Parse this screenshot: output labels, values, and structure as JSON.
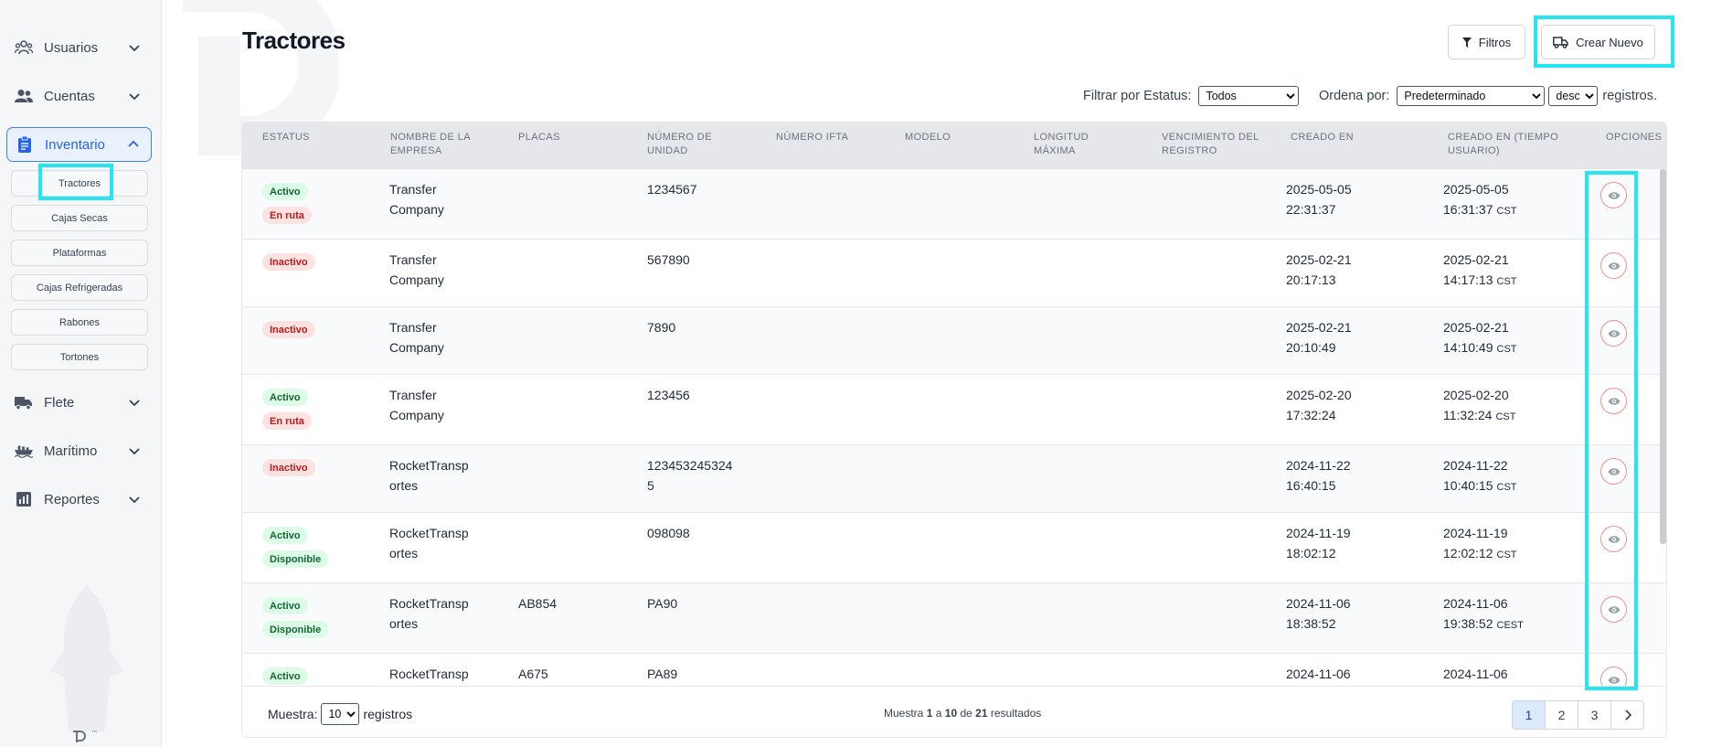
{
  "sidebar": {
    "items": [
      {
        "label": "Usuarios"
      },
      {
        "label": "Cuentas"
      },
      {
        "label": "Inventario"
      },
      {
        "label": "Flete"
      },
      {
        "label": "Marítimo"
      },
      {
        "label": "Reportes"
      }
    ],
    "inventory_sub": [
      "Tractores",
      "Cajas Secas",
      "Plataformas",
      "Cajas Refrigeradas",
      "Rabones",
      "Tortones"
    ],
    "footer_mark": "™"
  },
  "header": {
    "title": "Tractores",
    "filters_label": "Filtros",
    "create_label": "Crear Nuevo"
  },
  "filterbar": {
    "status_label": "Filtrar por Estatus:",
    "status_value": "Todos",
    "order_label": "Ordena por:",
    "order_value": "Predeterminado",
    "dir_value": "desc",
    "records_label": "registros."
  },
  "table": {
    "columns": [
      "ESTATUS",
      "NOMBRE DE LA EMPRESA",
      "PLACAS",
      "NÚMERO DE UNIDAD",
      "NÚMERO IFTA",
      "MODELO",
      "LONGITUD MÁXIMA",
      "VENCIMIENTO DEL REGISTRO",
      "CREADO EN",
      "CREADO EN (TIEMPO USUARIO)",
      "OPCIONES"
    ],
    "rows": [
      {
        "badges": [
          {
            "text": "Activo",
            "color": "#166534"
          },
          {
            "text": "En ruta",
            "color": "#b91c1c"
          }
        ],
        "company": [
          "Transfer",
          "Company"
        ],
        "plates": "",
        "unit": [
          "1234567",
          ""
        ],
        "created": [
          "2025-05-05",
          "22:31:37"
        ],
        "user_date": "2025-05-05",
        "user_time": "16:31:37",
        "tz": "CST"
      },
      {
        "badges": [
          {
            "text": "Inactivo",
            "color": "#b91c1c"
          }
        ],
        "company": [
          "Transfer",
          "Company"
        ],
        "plates": "",
        "unit": [
          "567890",
          ""
        ],
        "created": [
          "2025-02-21",
          "20:17:13"
        ],
        "user_date": "2025-02-21",
        "user_time": "14:17:13",
        "tz": "CST"
      },
      {
        "badges": [
          {
            "text": "Inactivo",
            "color": "#b91c1c"
          }
        ],
        "company": [
          "Transfer",
          "Company"
        ],
        "plates": "",
        "unit": [
          "7890",
          ""
        ],
        "created": [
          "2025-02-21",
          "20:10:49"
        ],
        "user_date": "2025-02-21",
        "user_time": "14:10:49",
        "tz": "CST"
      },
      {
        "badges": [
          {
            "text": "Activo",
            "color": "#166534"
          },
          {
            "text": "En ruta",
            "color": "#b91c1c"
          }
        ],
        "company": [
          "Transfer",
          "Company"
        ],
        "plates": "",
        "unit": [
          "123456",
          ""
        ],
        "created": [
          "2025-02-20",
          "17:32:24"
        ],
        "user_date": "2025-02-20",
        "user_time": "11:32:24",
        "tz": "CST"
      },
      {
        "badges": [
          {
            "text": "Inactivo",
            "color": "#b91c1c"
          }
        ],
        "company": [
          "RocketTransp",
          "ortes"
        ],
        "plates": "",
        "unit": [
          "123453245324",
          "5"
        ],
        "created": [
          "2024-11-22",
          "16:40:15"
        ],
        "user_date": "2024-11-22",
        "user_time": "10:40:15",
        "tz": "CST"
      },
      {
        "badges": [
          {
            "text": "Activo",
            "color": "#166534"
          },
          {
            "text": "Disponible",
            "color": "#166534"
          }
        ],
        "company": [
          "RocketTransp",
          "ortes"
        ],
        "plates": "",
        "unit": [
          "098098",
          ""
        ],
        "created": [
          "2024-11-19",
          "18:02:12"
        ],
        "user_date": "2024-11-19",
        "user_time": "12:02:12",
        "tz": "CST"
      },
      {
        "badges": [
          {
            "text": "Activo",
            "color": "#166534"
          },
          {
            "text": "Disponible",
            "color": "#166534"
          }
        ],
        "company": [
          "RocketTransp",
          "ortes"
        ],
        "plates": "AB854",
        "unit": [
          "PA90",
          ""
        ],
        "created": [
          "2024-11-06",
          "18:38:52"
        ],
        "user_date": "2024-11-06",
        "user_time": "19:38:52",
        "tz": "CEST"
      },
      {
        "badges": [
          {
            "text": "Activo",
            "color": "#166534"
          }
        ],
        "company": [
          "RocketTransp",
          ""
        ],
        "plates": "A675",
        "unit": [
          "PA89",
          ""
        ],
        "created": [
          "2024-11-06",
          ""
        ],
        "user_date": "2024-11-06",
        "user_time": "",
        "tz": ""
      }
    ]
  },
  "footer": {
    "show_label": "Muestra:",
    "show_value": "10",
    "records_label": "registros",
    "summary_prefix": "Muestra",
    "summary_from": "1",
    "summary_a": "a",
    "summary_to": "10",
    "summary_de": "de",
    "summary_total": "21",
    "summary_suffix": "resultados",
    "pages": [
      "1",
      "2",
      "3"
    ],
    "next_icon": "chevron-right-icon"
  },
  "colors": {
    "accent": "#3b82f6",
    "highlight": "#25e6f0",
    "active_badge_bg": "#dcfce7",
    "inactive_badge_bg": "#fde2e2"
  }
}
